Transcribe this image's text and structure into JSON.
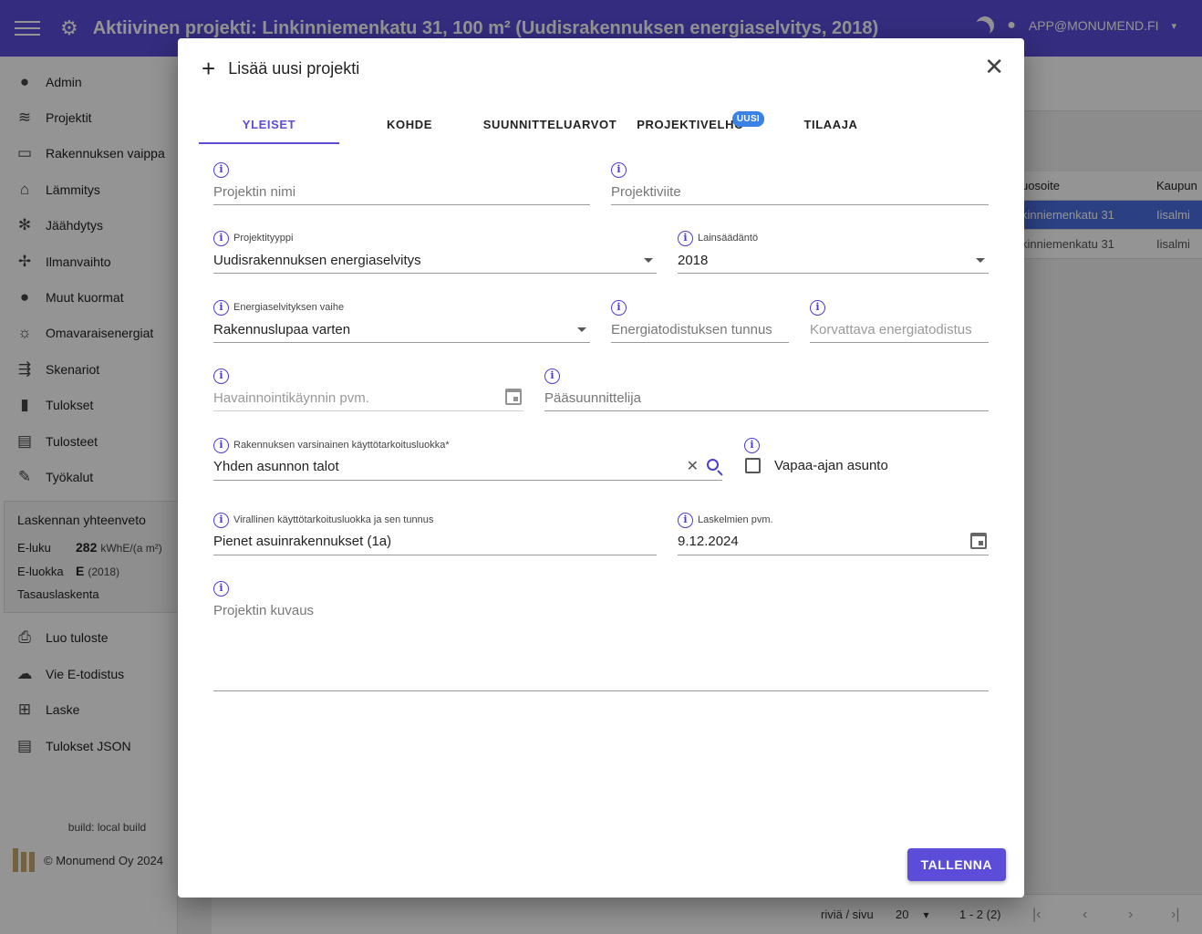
{
  "appbar": {
    "title": "Aktiivinen projekti: Linkinniemenkatu 31, 100 m² (Uudisrakennuksen energiaselvitys, 2018)",
    "user": "APP@MONUMEND.FI"
  },
  "sidebar": {
    "items": [
      {
        "label": "Admin",
        "icon": "user-icon",
        "glyph": "●"
      },
      {
        "label": "Projektit",
        "icon": "layers-icon",
        "glyph": "≋"
      },
      {
        "label": "Rakennuksen vaippa",
        "icon": "wall-icon",
        "glyph": "▭"
      },
      {
        "label": "Lämmitys",
        "icon": "house-heat-icon",
        "glyph": "⌂"
      },
      {
        "label": "Jäähdytys",
        "icon": "snowflake-icon",
        "glyph": "✻"
      },
      {
        "label": "Ilmanvaihto",
        "icon": "fan-icon",
        "glyph": "✢"
      },
      {
        "label": "Muut kuormat",
        "icon": "bulb-icon",
        "glyph": "●"
      },
      {
        "label": "Omavaraisenergiat",
        "icon": "sun-icon",
        "glyph": "☼"
      },
      {
        "label": "Skenariot",
        "icon": "scenario-icon",
        "glyph": "⇶"
      },
      {
        "label": "Tulokset",
        "icon": "bar-chart-icon",
        "glyph": "▮"
      },
      {
        "label": "Tulosteet",
        "icon": "document-icon",
        "glyph": "▤"
      },
      {
        "label": "Työkalut",
        "icon": "wrench-icon",
        "glyph": "✎"
      }
    ],
    "summary": {
      "title": "Laskennan yhteenveto",
      "eluku_label": "E-luku",
      "eluku_value": "282",
      "eluku_unit": "kWhE/(a m²)",
      "eluokka_label": "E-luokka",
      "eluokka_value": "E",
      "eluokka_year": "(2018)",
      "balance": "Tasauslaskenta"
    },
    "actions": [
      {
        "label": "Luo tuloste",
        "icon": "print-icon",
        "glyph": "⎙"
      },
      {
        "label": "Vie E-todistus",
        "icon": "cloud-upload-icon",
        "glyph": "☁"
      },
      {
        "label": "Laske",
        "icon": "calculator-icon",
        "glyph": "⊞"
      },
      {
        "label": "Tulokset JSON",
        "icon": "file-icon",
        "glyph": "▤"
      }
    ],
    "build": "build: local build",
    "copyright": "© Monumend Oy 2024"
  },
  "bg_table": {
    "col1": "uosoite",
    "col2": "Kaupun",
    "rows": [
      {
        "a": "kinniemenkatu 31",
        "b": "Iisalmi"
      },
      {
        "a": "kinniemenkatu 31",
        "b": "Iisalmi"
      }
    ]
  },
  "pager": {
    "rows_label": "riviä / sivu",
    "rows_value": "20",
    "range": "1 - 2 (2)"
  },
  "dialog": {
    "title": "Lisää uusi projekti",
    "tabs": [
      {
        "label": "YLEISET"
      },
      {
        "label": "KOHDE"
      },
      {
        "label": "SUUNNITTELUARVOT"
      },
      {
        "label": "PROJEKTIVELHO",
        "badge": "UUSI"
      },
      {
        "label": "TILAAJA"
      }
    ],
    "fields": {
      "project_name": {
        "placeholder": "Projektin nimi"
      },
      "project_ref": {
        "placeholder": "Projektiviite"
      },
      "project_type": {
        "label": "Projektityyppi",
        "value": "Uudisrakennuksen energiaselvitys"
      },
      "legislation": {
        "label": "Lainsäädäntö",
        "value": "2018"
      },
      "phase": {
        "label": "Energiaselvityksen vaihe",
        "value": "Rakennuslupaa varten"
      },
      "cert_id": {
        "placeholder": "Energiatodistuksen tunnus"
      },
      "replaced_cert": {
        "placeholder": "Korvattava energiatodistus"
      },
      "visit_date": {
        "placeholder": "Havainnointikäynnin pvm."
      },
      "designer": {
        "placeholder": "Pääsuunnittelija"
      },
      "usage_class": {
        "label": "Rakennuksen varsinainen käyttötarkoitusluokka*",
        "value": "Yhden asunnon talot"
      },
      "leisure": {
        "label": "Vapaa-ajan asunto"
      },
      "official_class": {
        "label": "Virallinen käyttötarkoitusluokka ja sen tunnus",
        "value": "Pienet asuinrakennukset (1a)"
      },
      "calc_date": {
        "label": "Laskelmien pvm.",
        "value": "9.12.2024"
      },
      "description": {
        "placeholder": "Projektin kuvaus"
      }
    },
    "save_label": "TALLENNA"
  }
}
